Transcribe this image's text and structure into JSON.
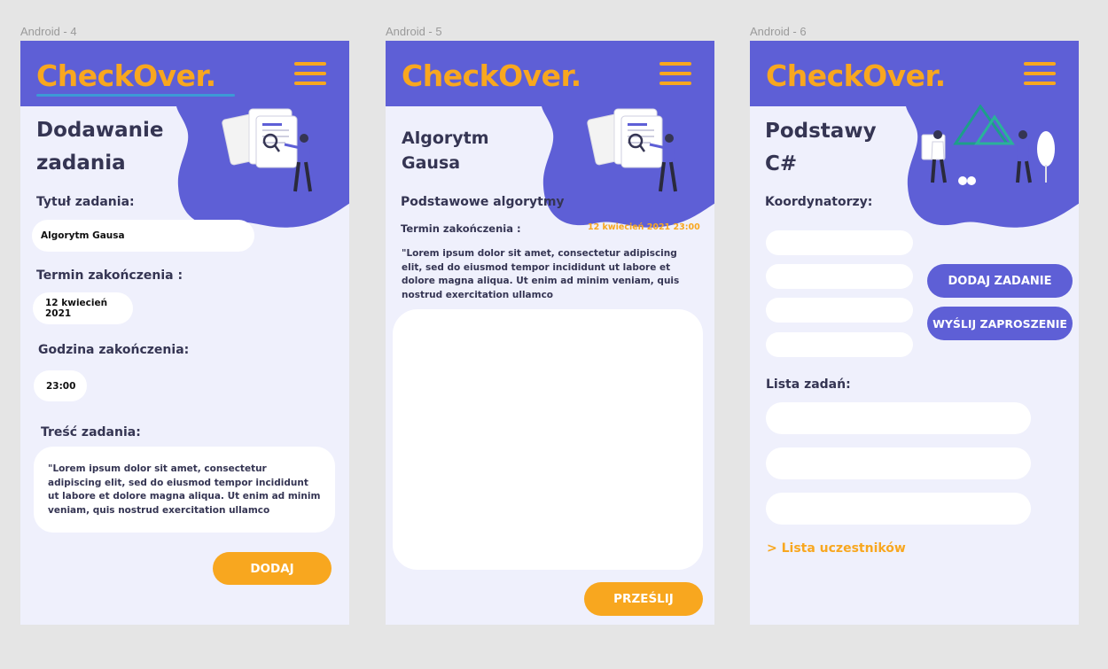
{
  "frames": [
    {
      "label": "Android - 4"
    },
    {
      "label": "Android - 5"
    },
    {
      "label": "Android - 6"
    }
  ],
  "brand": {
    "logo": "CheckOver.",
    "color": "#f8a71f",
    "header_color": "#5e5fd6"
  },
  "screen4": {
    "title_line1": "Dodawanie",
    "title_line2": "zadania",
    "task_title_label": "Tytuł zadania:",
    "task_title_value": "Algorytm Gausa",
    "deadline_label": "Termin zakończenia :",
    "deadline_value": "12 kwiecień 2021",
    "hour_label": "Godzina zakończenia:",
    "hour_value": "23:00",
    "content_label": "Treść zadania:",
    "content_value": "\"Lorem ipsum dolor sit amet, consectetur adipiscing elit, sed do eiusmod tempor incididunt ut labore et dolore magna aliqua. Ut enim ad minim veniam, quis nostrud exercitation ullamco",
    "add_button": "DODAJ"
  },
  "screen5": {
    "title_line1": "Algorytm",
    "title_line2": "Gausa",
    "subject": "Podstawowe algorytmy",
    "deadline_label": "Termin zakończenia :",
    "deadline_value": "12 kwiecień 2021 23:00",
    "description": "\"Lorem ipsum dolor sit amet, consectetur adipiscing elit, sed do eiusmod tempor incididunt ut labore et dolore magna aliqua. Ut enim ad minim veniam, quis nostrud exercitation ullamco",
    "answer_value": "",
    "send_button": "PRZEŚLIJ"
  },
  "screen6": {
    "title_line1": "Podstawy",
    "title_line2": "C#",
    "coordinators_label": "Koordynatorzy:",
    "coordinators": [
      "",
      "",
      "",
      ""
    ],
    "add_task_button": "DODAJ ZADANIE",
    "invite_button": "WYŚLIJ ZAPROSZENIE",
    "task_list_label": "Lista zadań:",
    "tasks": [
      "",
      "",
      ""
    ],
    "participants_link": "> Lista uczestników"
  }
}
